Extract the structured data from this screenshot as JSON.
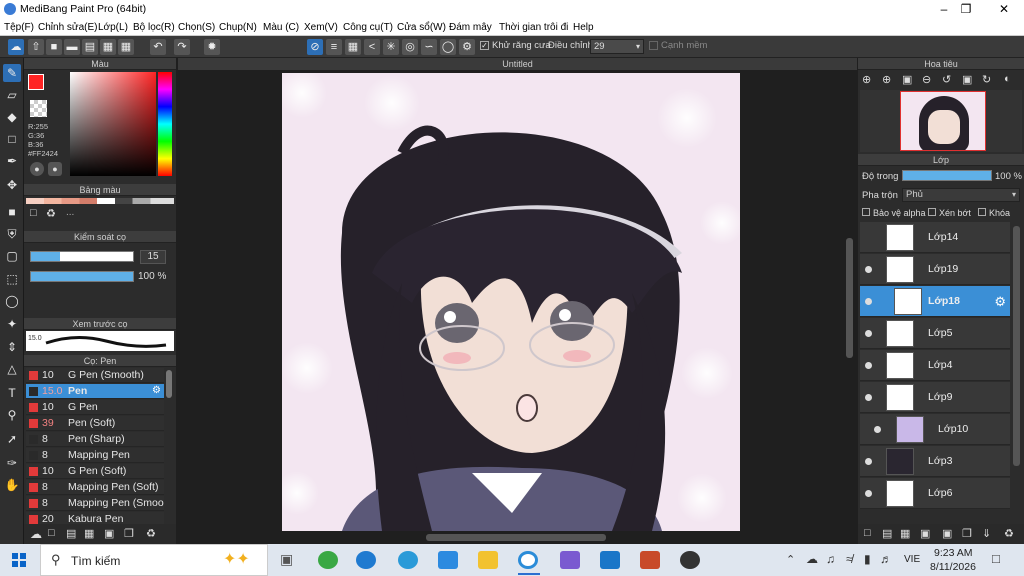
{
  "window": {
    "title": "MediBang Paint Pro (64bit)"
  },
  "menu": [
    "Tệp(F)",
    "Chỉnh sửa(E)",
    "Lớp(L)",
    "Bộ lọc(R)",
    "Chọn(S)",
    "Chụp(N)",
    "Màu (C)",
    "Xem(V)",
    "Công cụ(T)",
    "Cửa sổ(W)",
    "Đám mây",
    "Thời gian trôi đi",
    "Help"
  ],
  "toolbar": {
    "antialias_label": "Khử răng cưa",
    "adjust_label": "Điều chỉnh",
    "adjust_value": "29",
    "smooth_label": "Cạnh mềm"
  },
  "color_panel": {
    "title": "Màu",
    "rgb_r": "R:255",
    "rgb_g": "G:36",
    "rgb_b": "B:36",
    "hex": "#FF2424",
    "primary": "#ff2424"
  },
  "palette_panel": {
    "title": "Bảng màu",
    "ellipsis": "..."
  },
  "brush_control": {
    "title": "Kiểm soát cọ",
    "size": "15",
    "opacity": "100 %"
  },
  "preview_panel": {
    "title": "Xem trước cọ",
    "size_label": "15.0"
  },
  "brush_panel": {
    "title": "Cọ: Pen",
    "items": [
      {
        "size": "10",
        "name": "G Pen (Smooth)"
      },
      {
        "size": "15.0",
        "name": "Pen"
      },
      {
        "size": "10",
        "name": "G Pen"
      },
      {
        "size": "39",
        "name": "Pen (Soft)"
      },
      {
        "size": "8",
        "name": "Pen (Sharp)"
      },
      {
        "size": "8",
        "name": "Mapping Pen"
      },
      {
        "size": "10",
        "name": "G Pen (Soft)"
      },
      {
        "size": "8",
        "name": "Mapping Pen (Soft)"
      },
      {
        "size": "8",
        "name": "Mapping Pen (Smoo"
      },
      {
        "size": "20",
        "name": "Kabura Pen"
      }
    ]
  },
  "canvas": {
    "doc_title": "Untitled"
  },
  "navigator": {
    "title": "Hoa tiêu"
  },
  "layer_panel": {
    "title": "Lớp",
    "opacity_label": "Độ trong",
    "opacity_value": "100 %",
    "blend_label": "Pha trộn",
    "blend_value": "Phủ",
    "protect_alpha": "Bảo vệ alpha",
    "clip": "Xén bớt",
    "lock": "Khóa",
    "layers": [
      "Lớp14",
      "Lớp19",
      "Lớp18",
      "Lớp5",
      "Lớp4",
      "Lớp9",
      "Lớp10",
      "Lớp3",
      "Lớp6"
    ]
  },
  "taskbar": {
    "search_placeholder": "Tìm kiếm",
    "lang": "VIE",
    "time": "9:23 AM",
    "date": "8/11/2026"
  }
}
